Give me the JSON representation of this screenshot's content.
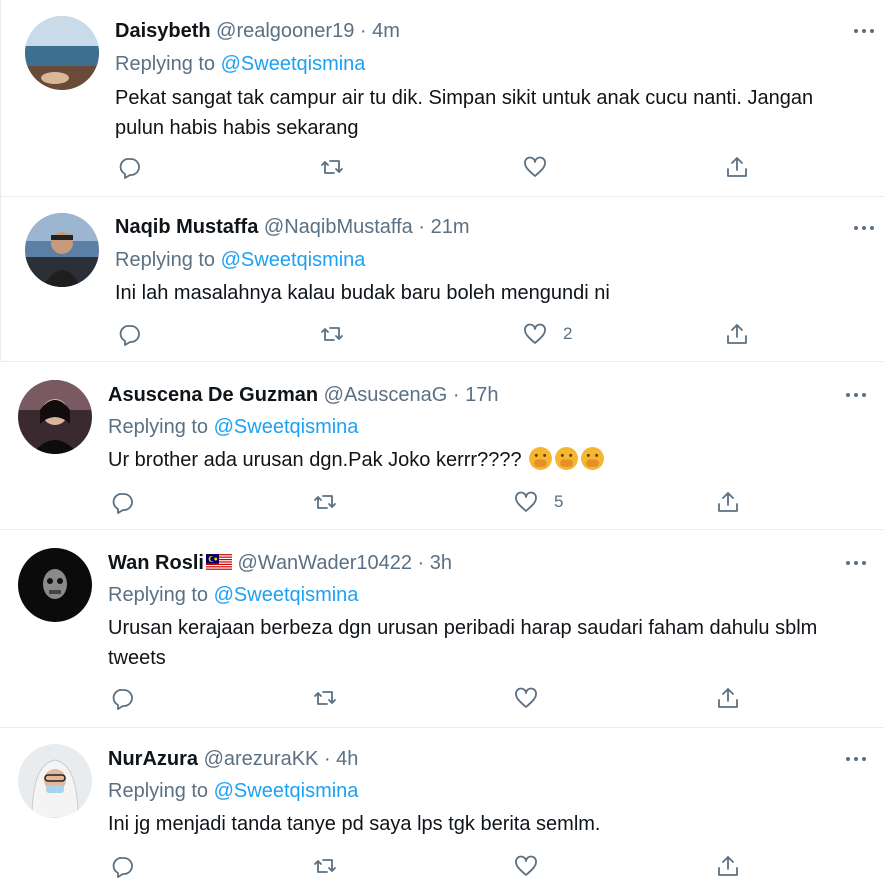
{
  "tweets": [
    {
      "display_name": "Daisybeth",
      "handle": "@realgooner19",
      "separator": "·",
      "time": "4m",
      "replying_prefix": "Replying to",
      "replying_to": "@Sweetqismina",
      "text": "Pekat sangat tak campur air tu dik. Simpan sikit untuk anak cucu nanti. Jangan pulun habis habis sekarang",
      "like_count": ""
    },
    {
      "display_name": "Naqib Mustaffa",
      "handle": "@NaqibMustaffa",
      "separator": "·",
      "time": "21m",
      "replying_prefix": "Replying to",
      "replying_to": "@Sweetqismina",
      "text": "Ini lah masalahnya kalau budak baru boleh mengundi ni",
      "like_count": "2"
    },
    {
      "display_name": "Asuscena De Guzman",
      "handle": "@AsuscenaG",
      "separator": "·",
      "time": "17h",
      "replying_prefix": "Replying to",
      "replying_to": "@Sweetqismina",
      "text": "Ur brother ada urusan dgn.Pak Joko kerrr????",
      "like_count": "5"
    },
    {
      "display_name": "Wan Rosli",
      "handle": "@WanWader10422",
      "separator": "·",
      "time": "3h",
      "replying_prefix": "Replying to",
      "replying_to": "@Sweetqismina",
      "text": "Urusan kerajaan berbeza dgn urusan peribadi harap saudari faham dahulu sblm tweets",
      "like_count": ""
    },
    {
      "display_name": "NurAzura",
      "handle": "@arezuraKK",
      "separator": "·",
      "time": "4h",
      "replying_prefix": "Replying to",
      "replying_to": "@Sweetqismina",
      "text": "Ini jg menjadi tanda tanye pd saya lps tgk berita semlm.",
      "like_count": ""
    }
  ],
  "colors": {
    "accent": "#1da1f2",
    "secondary_text": "#5b7083",
    "divider": "#e6ecf0"
  },
  "icons": [
    "reply-icon",
    "retweet-icon",
    "like-icon",
    "share-icon",
    "more-icon",
    "malaysia-flag-icon",
    "hand-over-mouth-emoji"
  ]
}
